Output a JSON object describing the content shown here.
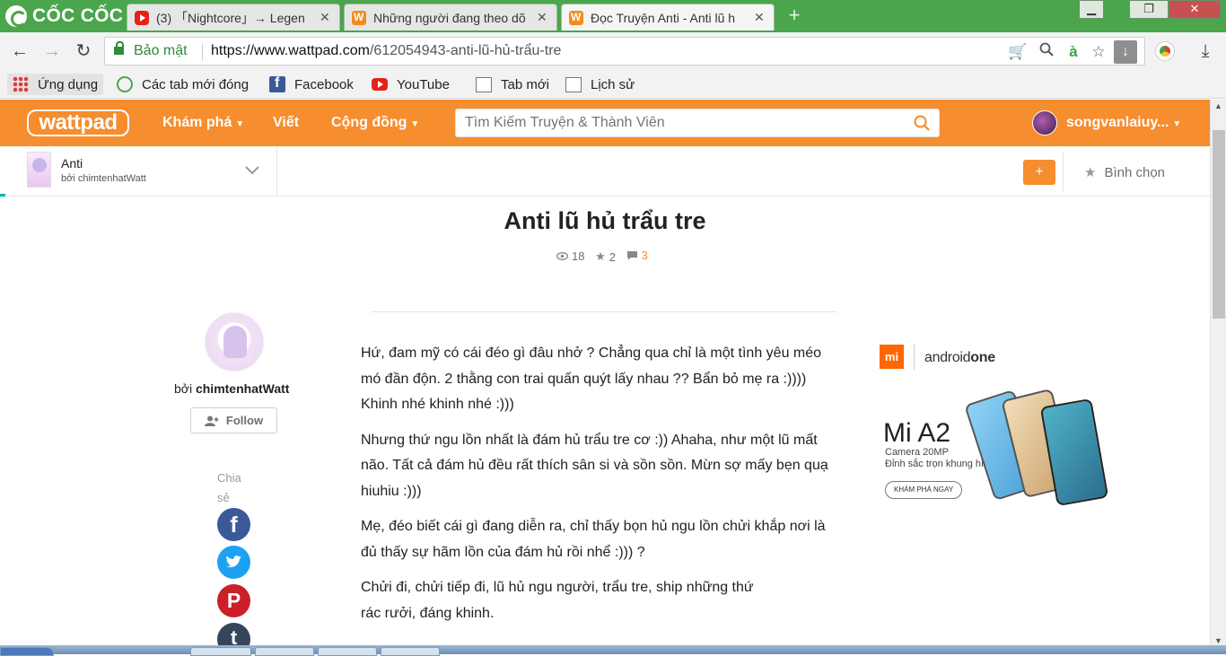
{
  "browser": {
    "brand": "CỐC CỐC",
    "tabs": [
      {
        "title": "(3) 「Nightcore」→ Legen",
        "favicon": "youtube-icon",
        "active": false
      },
      {
        "title": "Những người đang theo dõ",
        "favicon": "wattpad-icon",
        "active": false
      },
      {
        "title": "Đọc Truyện Anti - Anti lũ h",
        "favicon": "wattpad-icon",
        "active": true
      }
    ],
    "new_tab": "+",
    "window_controls": {
      "minimize": "▁",
      "restore": "❐",
      "close": "✕"
    },
    "secure_label": "Bảo mật",
    "url_host": "https://www.wattpad.com",
    "url_path": "/612054943-anti-lũ-hủ-trẩu-tre",
    "bookmarks": [
      {
        "label": "Ứng dụng",
        "icon": "apps-grid-icon"
      },
      {
        "label": "Các tab mới đóng",
        "icon": "history-icon"
      },
      {
        "label": "Facebook",
        "icon": "facebook-icon"
      },
      {
        "label": "YouTube",
        "icon": "youtube-icon"
      },
      {
        "label": "Tab mới",
        "icon": "page-icon"
      },
      {
        "label": "Lịch sử",
        "icon": "page-icon"
      }
    ]
  },
  "wattpad": {
    "logo": "wattpad",
    "nav": {
      "discover": "Khám phá",
      "write": "Viết",
      "community": "Cộng đồng"
    },
    "search_placeholder": "Tìm Kiếm Truyện & Thành Viên",
    "username": "songvanlaiuy...",
    "accent": "#f68d2e"
  },
  "story": {
    "title": "Anti",
    "by": "bởi chimtenhatWatt",
    "add_label": "+",
    "vote_label": "Bình chọn"
  },
  "chapter": {
    "title": "Anti lũ hủ trẩu tre",
    "stats": {
      "reads": "18",
      "votes": "2",
      "comments": "3"
    },
    "author_prefix": "bởi",
    "author": "chimtenhatWatt",
    "follow": "Follow",
    "share_label": "Chia sẻ",
    "share": [
      "facebook",
      "twitter",
      "pinterest",
      "tumblr"
    ],
    "paragraphs": [
      " Hứ, đam mỹ có cái đéo gì đâu nhở ? Chẳng qua chỉ là một tình yêu méo mó đần độn. 2 thằng con trai quấn quýt lấy nhau ?? Bẩn bỏ mẹ ra :)))) Khinh nhé khinh nhé :)))",
      "Nhưng thứ ngu lồn nhất là đám hủ trẩu tre cơ :)) Ahaha, như một lũ mất não. Tất cả đám hủ đều rất thích sân si và sồn sồn. Mừn sợ mấy bẹn quạ hiuhiu :)))",
      " Mẹ, đéo biết cái gì đang diễn ra, chỉ thấy bọn hủ ngu lồn chửi khắp nơi là đủ thấy sự hãm lồn của đám hủ rồi nhể :))) ?",
      "Chửi đi, chửi tiếp đi, lũ hủ ngu người, trẩu tre, ship những thứ rác rưởi, đáng khinh."
    ]
  },
  "ad": {
    "brand": "mi",
    "partner_prefix": "android",
    "partner_suffix": "one",
    "model": "Mi A2",
    "line1": "Camera 20MP",
    "line2": "Đỉnh sắc trọn khung hình",
    "cta": "KHÁM PHÁ NGAY"
  }
}
